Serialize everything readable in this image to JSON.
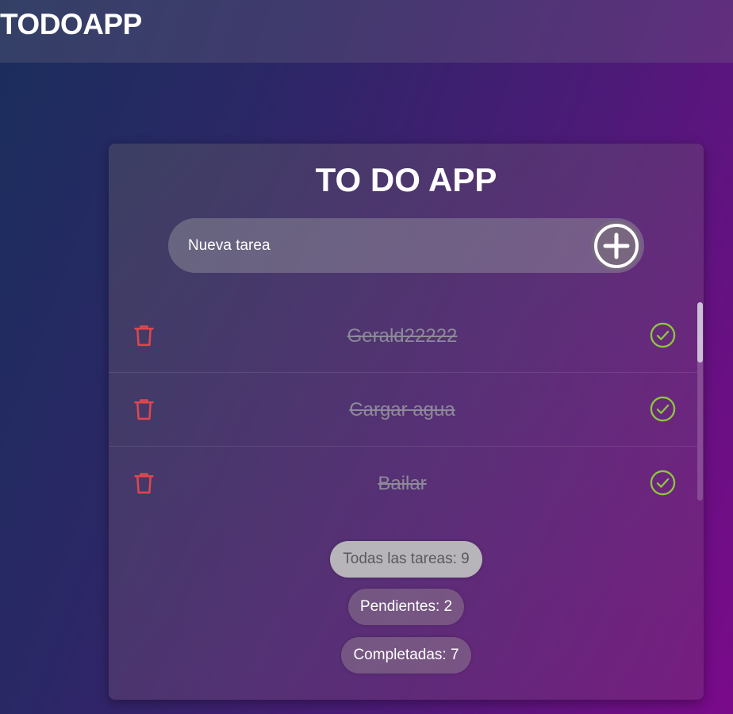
{
  "header": {
    "brand": "TODOAPP"
  },
  "card": {
    "title": "TO DO APP",
    "new_task": {
      "placeholder": "Nueva tarea",
      "value": ""
    },
    "add_button_icon": "plus-circle-icon"
  },
  "tasks": [
    {
      "text": "Gerald22222",
      "completed": true
    },
    {
      "text": "Cargar agua",
      "completed": true
    },
    {
      "text": "Bailar",
      "completed": true
    }
  ],
  "filters": {
    "all": "Todas las tareas: 9",
    "pending": "Pendientes: 2",
    "completed": "Completadas: 7"
  },
  "colors": {
    "trash": "#e0474c",
    "check": "#8dc63f"
  }
}
